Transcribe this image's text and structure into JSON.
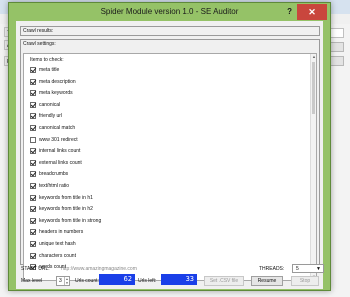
{
  "dialog": {
    "title": "Spider Module version 1.0 - SE Auditor",
    "help": "?",
    "close": "✕"
  },
  "background": {
    "tab_1": "Ta",
    "tab_2": "An",
    "tab_3": "PO"
  },
  "crawl_results_label": "Crawl results:",
  "crawl_settings_label": "Crawl settings:",
  "items_to_check_label": "Items to check:",
  "items": [
    {
      "label": "meta title",
      "checked": true
    },
    {
      "label": "meta description",
      "checked": true
    },
    {
      "label": "meta keywords",
      "checked": true
    },
    {
      "label": "canonical",
      "checked": true
    },
    {
      "label": "friendly url",
      "checked": true
    },
    {
      "label": "canonical match",
      "checked": true
    },
    {
      "label": "www 301 redirect",
      "checked": false
    },
    {
      "label": "internal links count",
      "checked": true
    },
    {
      "label": "external links count",
      "checked": true
    },
    {
      "label": "breadcrumbs",
      "checked": true
    },
    {
      "label": "text/html ratio",
      "checked": true
    },
    {
      "label": "keywords from title in h1",
      "checked": true
    },
    {
      "label": "keywords from title in h2",
      "checked": true
    },
    {
      "label": "keywords from title in strong",
      "checked": true
    },
    {
      "label": "headers in numbers",
      "checked": true
    },
    {
      "label": "unique text hash",
      "checked": true
    },
    {
      "label": "characters count",
      "checked": true
    },
    {
      "label": "words count",
      "checked": true
    }
  ],
  "start_url_label": "START URL:",
  "start_url_value": "http://www.amazingmagazine.com",
  "threads_label": "THREADS:",
  "threads_value": "5",
  "max_level_label": "Max level",
  "max_level_value": "3",
  "urls_count_label": "Urls count:",
  "urls_count_value": "62",
  "urls_left_label": "Urls left:",
  "urls_left_value": "33",
  "buttons": {
    "csv": "Set .CSV file",
    "resume": "Resume",
    "stop": "Stop"
  },
  "colors": {
    "title_bar": "#95c267",
    "counter_bg": "#1a3fe8",
    "close_bg": "#c9463d"
  }
}
